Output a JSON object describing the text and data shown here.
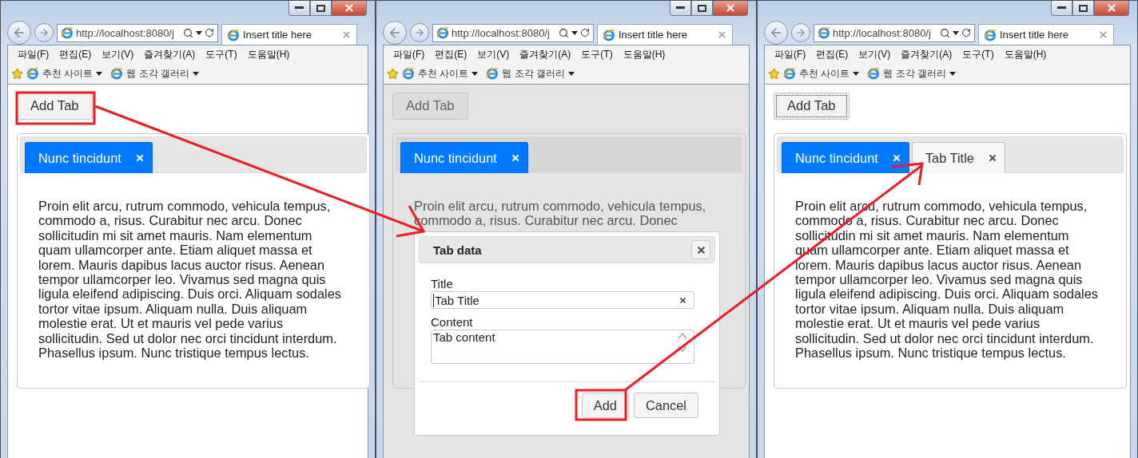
{
  "windows": [
    {
      "browser": {
        "address": "http://localhost:8080/j",
        "tab_title": "Insert title here",
        "menu": [
          "파일(F)",
          "편집(E)",
          "보기(V)",
          "즐겨찾기(A)",
          "도구(T)",
          "도움말(H)"
        ],
        "favorites": [
          "추천 사이트",
          "웹 조각 갤러리"
        ]
      },
      "page": {
        "dimmed": false,
        "add_button": {
          "label": "Add Tab",
          "focused": false
        },
        "tabs": [
          {
            "label": "Nunc tincidunt",
            "selected": true
          }
        ],
        "paragraph": "Proin elit arcu, rutrum commodo, vehicula tempus, commodo a, risus. Curabitur nec arcu. Donec sollicitudin mi sit amet mauris. Nam elementum quam ullamcorper ante. Etiam aliquet massa et lorem. Mauris dapibus lacus auctor risus. Aenean tempor ullamcorper leo. Vivamus sed magna quis ligula eleifend adipiscing. Duis orci. Aliquam sodales tortor vitae ipsum. Aliquam nulla. Duis aliquam molestie erat. Ut et mauris vel pede varius sollicitudin. Sed ut dolor nec orci tincidunt interdum. Phasellus ipsum. Nunc tristique tempus lectus."
      }
    },
    {
      "browser": {
        "address": "http://localhost:8080/j",
        "tab_title": "Insert title here",
        "menu": [
          "파일(F)",
          "편집(E)",
          "보기(V)",
          "즐겨찾기(A)",
          "도구(T)",
          "도움말(H)"
        ],
        "favorites": [
          "추천 사이트",
          "웹 조각 갤러리"
        ]
      },
      "page": {
        "dimmed": true,
        "add_button": {
          "label": "Add Tab",
          "focused": false
        },
        "tabs": [
          {
            "label": "Nunc tincidunt",
            "selected": true
          }
        ],
        "paragraph": "Proin elit arcu, rutrum commodo, vehicula tempus, commodo a, risus. Curabitur nec arcu. Donec"
      },
      "dialog": {
        "title": "Tab data",
        "fields": [
          {
            "kind": "input",
            "label": "Title",
            "value": "Tab Title"
          },
          {
            "kind": "textarea",
            "label": "Content",
            "value": "Tab content"
          }
        ],
        "buttons": [
          "Add",
          "Cancel"
        ]
      }
    },
    {
      "browser": {
        "address": "http://localhost:8080/j",
        "tab_title": "Insert title here",
        "menu": [
          "파일(F)",
          "편집(E)",
          "보기(V)",
          "즐겨찾기(A)",
          "도구(T)",
          "도움말(H)"
        ],
        "favorites": [
          "추천 사이트",
          "웹 조각 갤러리"
        ]
      },
      "page": {
        "dimmed": false,
        "add_button": {
          "label": "Add Tab",
          "focused": true
        },
        "tabs": [
          {
            "label": "Nunc tincidunt",
            "selected": true
          },
          {
            "label": "Tab Title",
            "selected": false
          }
        ],
        "paragraph": "Proin elit arcu, rutrum commodo, vehicula tempus, commodo a, risus. Curabitur nec arcu. Donec sollicitudin mi sit amet mauris. Nam elementum quam ullamcorper ante. Etiam aliquet massa et lorem. Mauris dapibus lacus auctor risus. Aenean tempor ullamcorper leo. Vivamus sed magna quis ligula eleifend adipiscing. Duis orci. Aliquam sodales tortor vitae ipsum. Aliquam nulla. Duis aliquam molestie erat. Ut et mauris vel pede varius sollicitudin. Sed ut dolor nec orci tincidunt interdum. Phasellus ipsum. Nunc tristique tempus lectus."
      }
    }
  ]
}
